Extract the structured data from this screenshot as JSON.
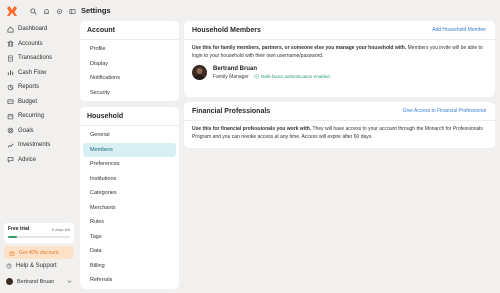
{
  "header": {
    "title": "Settings"
  },
  "sidebar": {
    "nav": [
      {
        "label": "Dashboard",
        "icon": "dashboard-icon"
      },
      {
        "label": "Accounts",
        "icon": "bank-icon"
      },
      {
        "label": "Transactions",
        "icon": "receipt-icon"
      },
      {
        "label": "Cash Flow",
        "icon": "bar-chart-icon"
      },
      {
        "label": "Reports",
        "icon": "reports-icon"
      },
      {
        "label": "Budget",
        "icon": "budget-icon"
      },
      {
        "label": "Recurring",
        "icon": "calendar-icon"
      },
      {
        "label": "Goals",
        "icon": "target-icon"
      },
      {
        "label": "Investments",
        "icon": "trend-icon"
      },
      {
        "label": "Advice",
        "icon": "advice-icon"
      }
    ],
    "trial": {
      "title": "Free trial",
      "days_left": "6 days left",
      "progress": 0.14
    },
    "discount_label": "Get 40% discount",
    "help_label": "Help & Support",
    "user_name": "Bertrand Bruan"
  },
  "account_nav": {
    "title": "Account",
    "items": [
      "Profile",
      "Display",
      "Notifications",
      "Security"
    ]
  },
  "household_nav": {
    "title": "Household",
    "items": [
      "General",
      "Members",
      "Preferences",
      "Institutions",
      "Categories",
      "Merchants",
      "Rules",
      "Tags",
      "Data",
      "Billing",
      "Referrals"
    ],
    "active": "Members"
  },
  "members_panel": {
    "title": "Household Members",
    "action": "Add Household Member",
    "desc_bold": "Use this for family members, partners, or someone else you manage your household with.",
    "desc_rest": " Members you invite will be able to login to your household with their own username/password.",
    "member": {
      "name": "Bertrand Bruan",
      "role": "Family Manager",
      "mfa": "Multi-factor authentication enabled"
    }
  },
  "pros_panel": {
    "title": "Financial Professionals",
    "action": "Give Access to Financial Professional",
    "desc_bold": "Use this for financial professionals you work with.",
    "desc_rest": " They will have access to your account through the Monarch for Professionals Program and you can revoke access at any time. Access will expire after 60 days."
  },
  "colors": {
    "accent": "#ff692d",
    "link": "#3a7bd5",
    "active_bg": "#d8eff3",
    "success": "#2e9d6a"
  }
}
